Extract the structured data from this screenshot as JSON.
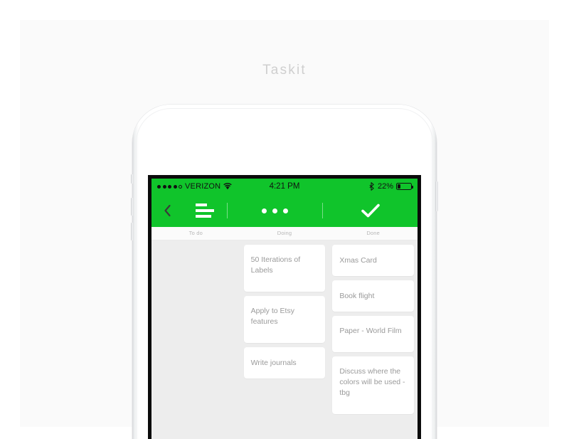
{
  "page": {
    "title": "Taskit",
    "background_color": "#FFFFFF",
    "panel_color": "#FAFAFA"
  },
  "theme": {
    "accent_green": "#10C42B",
    "board_background": "#EDEDED",
    "card_background": "#FFFFFF",
    "card_text": "#9A9A9A",
    "header_text": "#B6B6B6"
  },
  "device": {
    "name": "iphone-mockup",
    "hardware": {
      "front_camera": "front-camera",
      "proximity_sensor": "proximity-sensor",
      "earpiece_speaker": "earpiece-speaker",
      "mute_switch": "mute-switch",
      "volume_up": "volume-up-button",
      "volume_down": "volume-down-button",
      "power": "power-button"
    }
  },
  "status_bar": {
    "signal_bars_filled": 4,
    "signal_bars_empty": 1,
    "carrier": "VERIZON",
    "wifi_icon": "wifi-icon",
    "time": "4:21 PM",
    "bluetooth_icon": "bluetooth-icon",
    "battery_percent": "22%",
    "battery_level": 22,
    "battery_icon": "battery-icon"
  },
  "nav_bar": {
    "back_icon": "chevron-left-icon",
    "menu_icon": "list-icon",
    "more_icon": "ellipsis-icon",
    "done_icon": "checkmark-icon"
  },
  "board": {
    "columns": [
      {
        "title": "To do",
        "cards": []
      },
      {
        "title": "Doing",
        "cards": [
          "50 Iterations of Labels",
          "Apply to Etsy features",
          "Write journals"
        ]
      },
      {
        "title": "Done",
        "cards": [
          "Xmas Card",
          "Book flight",
          "Paper - World Film",
          "Discuss where the colors will be used -tbg"
        ]
      }
    ]
  }
}
